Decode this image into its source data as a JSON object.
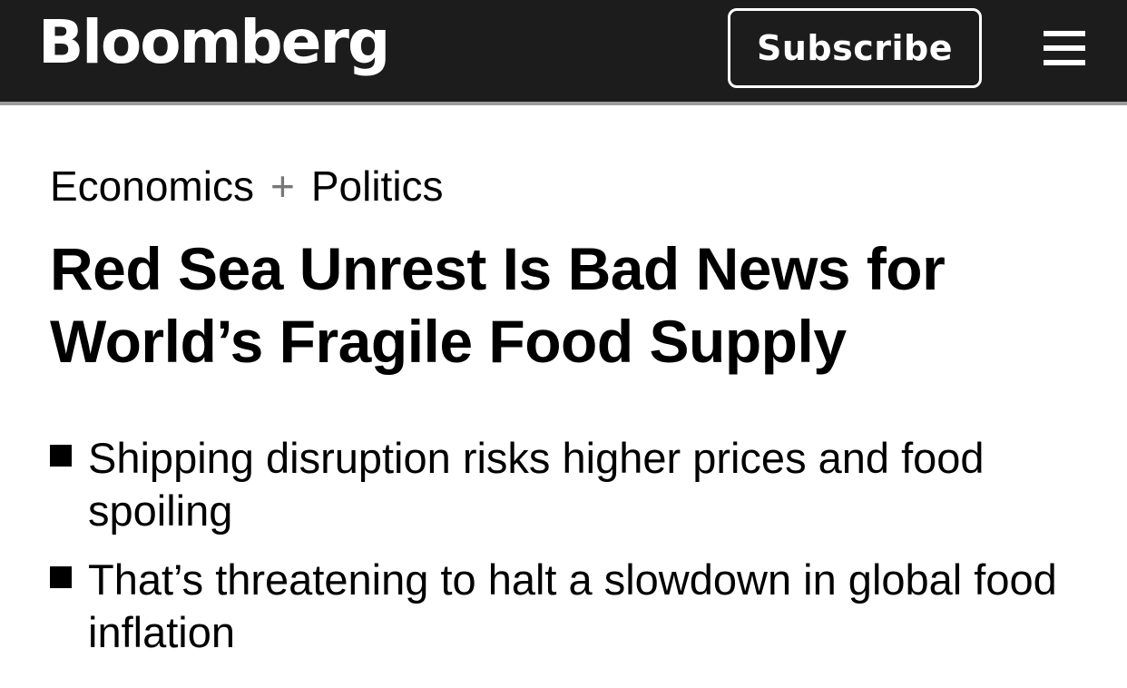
{
  "header": {
    "logo": "Bloomberg",
    "subscribe_label": "Subscribe",
    "menu_icon": "hamburger-menu-icon",
    "background_color": "#1c1c1c"
  },
  "article": {
    "kicker": {
      "section_1": "Economics",
      "separator": "+",
      "section_2": "Politics"
    },
    "headline": "Red Sea Unrest Is Bad News for World’s Fragile Food Supply",
    "bullets": [
      "Shipping disruption risks higher prices and food spoiling",
      "That’s threatening to halt a slowdown in global food inflation"
    ]
  }
}
